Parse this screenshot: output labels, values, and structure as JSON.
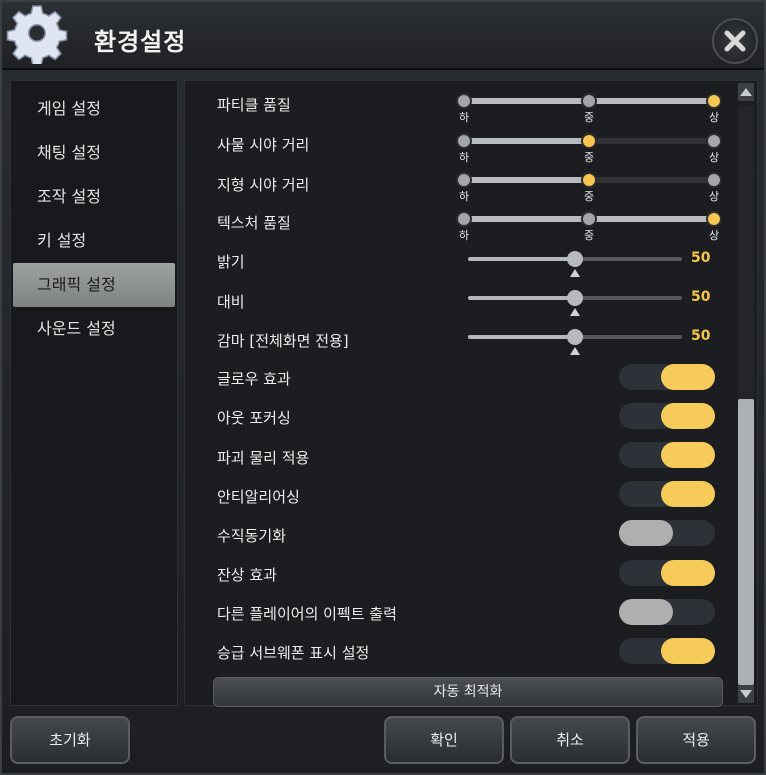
{
  "window": {
    "title": "환경설정"
  },
  "sidebar": {
    "items": [
      {
        "label": "게임 설정"
      },
      {
        "label": "채팅 설정"
      },
      {
        "label": "조작 설정"
      },
      {
        "label": "키 설정"
      },
      {
        "label": "그래픽 설정",
        "active": true
      },
      {
        "label": "사운드 설정"
      }
    ]
  },
  "graphics": {
    "level_labels": {
      "low": "하",
      "mid": "중",
      "high": "상"
    },
    "particle_quality": {
      "label": "파티클 품질",
      "value": "상"
    },
    "object_view_distance": {
      "label": "사물 시야 거리",
      "value": "중"
    },
    "terrain_view_distance": {
      "label": "지형 시야 거리",
      "value": "중"
    },
    "texture_quality": {
      "label": "텍스처 품질",
      "value": "상"
    },
    "brightness": {
      "label": "밝기",
      "value": "50"
    },
    "contrast": {
      "label": "대비",
      "value": "50"
    },
    "gamma": {
      "label": "감마 [전체화면 전용]",
      "value": "50"
    },
    "toggles": [
      {
        "label": "글로우 효과",
        "on": true
      },
      {
        "label": "아웃 포커싱",
        "on": true
      },
      {
        "label": "파괴 물리 적용",
        "on": true
      },
      {
        "label": "안티알리어싱",
        "on": true
      },
      {
        "label": "수직동기화",
        "on": false
      },
      {
        "label": "잔상 효과",
        "on": true
      },
      {
        "label": "다른 플레이어의 이펙트 출력",
        "on": false
      },
      {
        "label": "승급 서브웨폰 표시 설정",
        "on": true
      }
    ],
    "auto_optimize_label": "자동 최적화"
  },
  "buttons": {
    "reset": "초기화",
    "confirm": "확인",
    "cancel": "취소",
    "apply": "적용"
  },
  "colors": {
    "accent": "#f6c651",
    "active_tab": "#9ea29e"
  }
}
